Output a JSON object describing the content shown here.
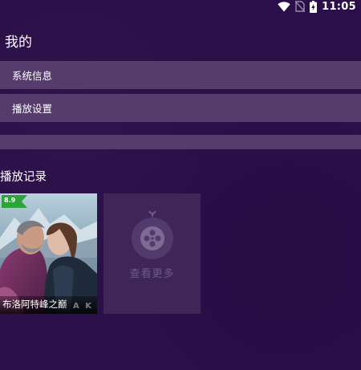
{
  "status_bar": {
    "time": "11:05",
    "icons": [
      "wifi-icon",
      "no-sim-icon",
      "battery-charging-icon"
    ]
  },
  "page": {
    "title": "我的"
  },
  "menu": {
    "items": [
      {
        "label": "系统信息"
      },
      {
        "label": "播放设置"
      }
    ]
  },
  "history": {
    "title": "播放记录",
    "items": [
      {
        "title": "布洛阿特峰之巅",
        "rating": "8.9",
        "overlay_text": "A K"
      }
    ],
    "more_label": "查看更多"
  },
  "colors": {
    "background": "#2a0f49",
    "menu_item": "#553c6d",
    "more_card": "#3e2659",
    "rating_badge": "#2da33a",
    "more_text": "#6f5a84"
  }
}
